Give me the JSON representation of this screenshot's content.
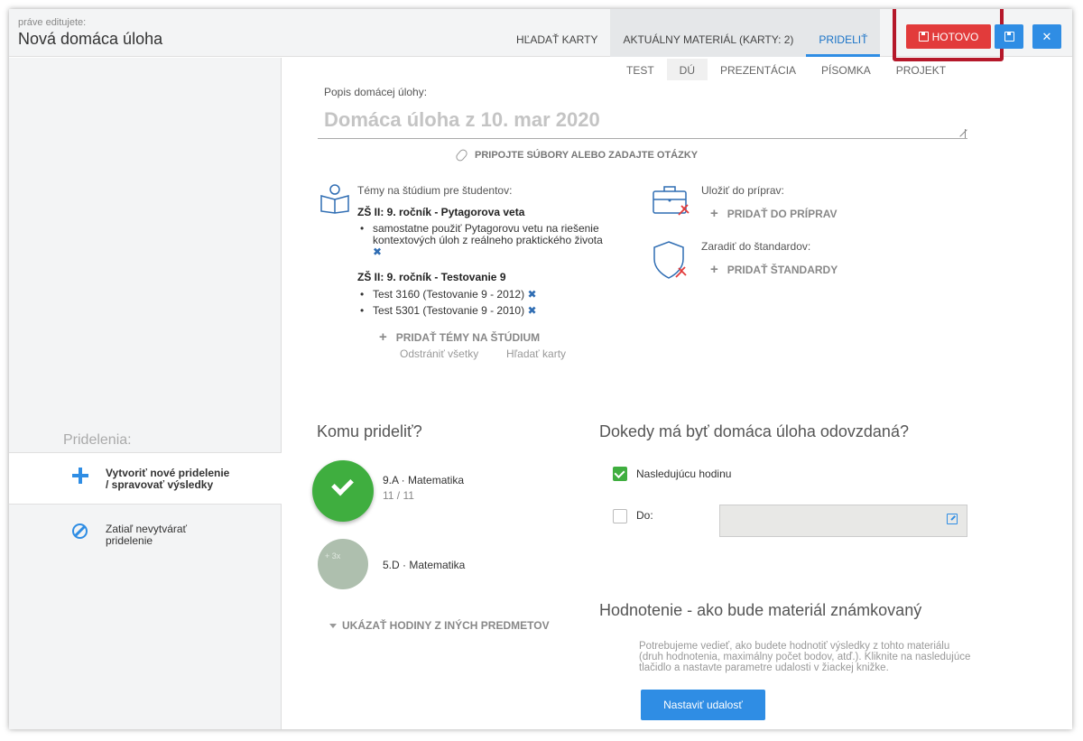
{
  "header": {
    "editing_label": "práve editujete:",
    "title": "Nová domáca úloha",
    "tabs": [
      {
        "label": "HĽADAŤ KARTY"
      },
      {
        "label": "AKTUÁLNY MATERIÁL (KARTY: 2)"
      },
      {
        "label": "PRIDELIŤ"
      }
    ],
    "done_label": "HOTOVO",
    "accent_color": "#2f8de4",
    "done_color": "#e23b3b"
  },
  "type_tabs": [
    "TEST",
    "DÚ",
    "PREZENTÁCIA",
    "PÍSOMKA",
    "PROJEKT"
  ],
  "description": {
    "label": "Popis domácej úlohy:",
    "value": "Domáca úloha z 10. mar 2020"
  },
  "attach_label": "PRIPOJTE SÚBORY ALEBO ZADAJTE OTÁZKY",
  "topics": {
    "label": "Témy na štúdium pre študentov:",
    "groups": [
      {
        "title": "ZŠ II: 9. ročník - Pytagorova veta",
        "items": [
          "samostatne použiť Pytagorovu vetu na riešenie",
          "kontextových úloh z reálneho praktického života"
        ]
      },
      {
        "title": "ZŠ II: 9. ročník - Testovanie 9",
        "items": [
          "Test 3160 (Testovanie 9 - 2012)",
          "Test 5301 (Testovanie 9 - 2010)"
        ]
      }
    ],
    "add_label": "PRIDAŤ TÉMY NA ŠTÚDIUM",
    "remove_all": "Odstrániť všetky",
    "search_cards": "Hľadať karty"
  },
  "prep": {
    "label": "Uložiť do príprav:",
    "add_label": "PRIDAŤ DO PRÍPRAV"
  },
  "standards": {
    "label": "Zaradiť do štandardov:",
    "add_label": "PRIDAŤ ŠTANDARDY"
  },
  "sidebar": {
    "title": "Pridelenia:",
    "items": [
      {
        "line1": "Vytvoriť nové pridelenie",
        "line2": "/ spravovať výsledky"
      },
      {
        "line1": "Zatiaľ nevytvárať",
        "line2": "pridelenie"
      }
    ]
  },
  "assign": {
    "heading": "Komu prideliť?",
    "classes": [
      {
        "name": "9.A · Matematika",
        "count": "11 / 11"
      },
      {
        "name": "5.D · Matematika",
        "count": ""
      }
    ],
    "show_more": "UKÁZAŤ HODINY Z INÝCH PREDMETOV"
  },
  "deadline": {
    "heading": "Dokedy má byť domáca úloha odovzdaná?",
    "next_lesson": "Nasledujúcu hodinu",
    "until": "Do:"
  },
  "grading": {
    "heading": "Hodnotenie - ako bude materiál známkovaný",
    "text": "Potrebujeme vedieť, ako budete hodnotiť výsledky z tohto materiálu (druh hodnotenia, maximálny počet bodov, atď.). Kliknite na nasledujúce tlačidlo a nastavte parametre udalosti v žiackej knižke.",
    "button": "Nastaviť udalosť"
  }
}
